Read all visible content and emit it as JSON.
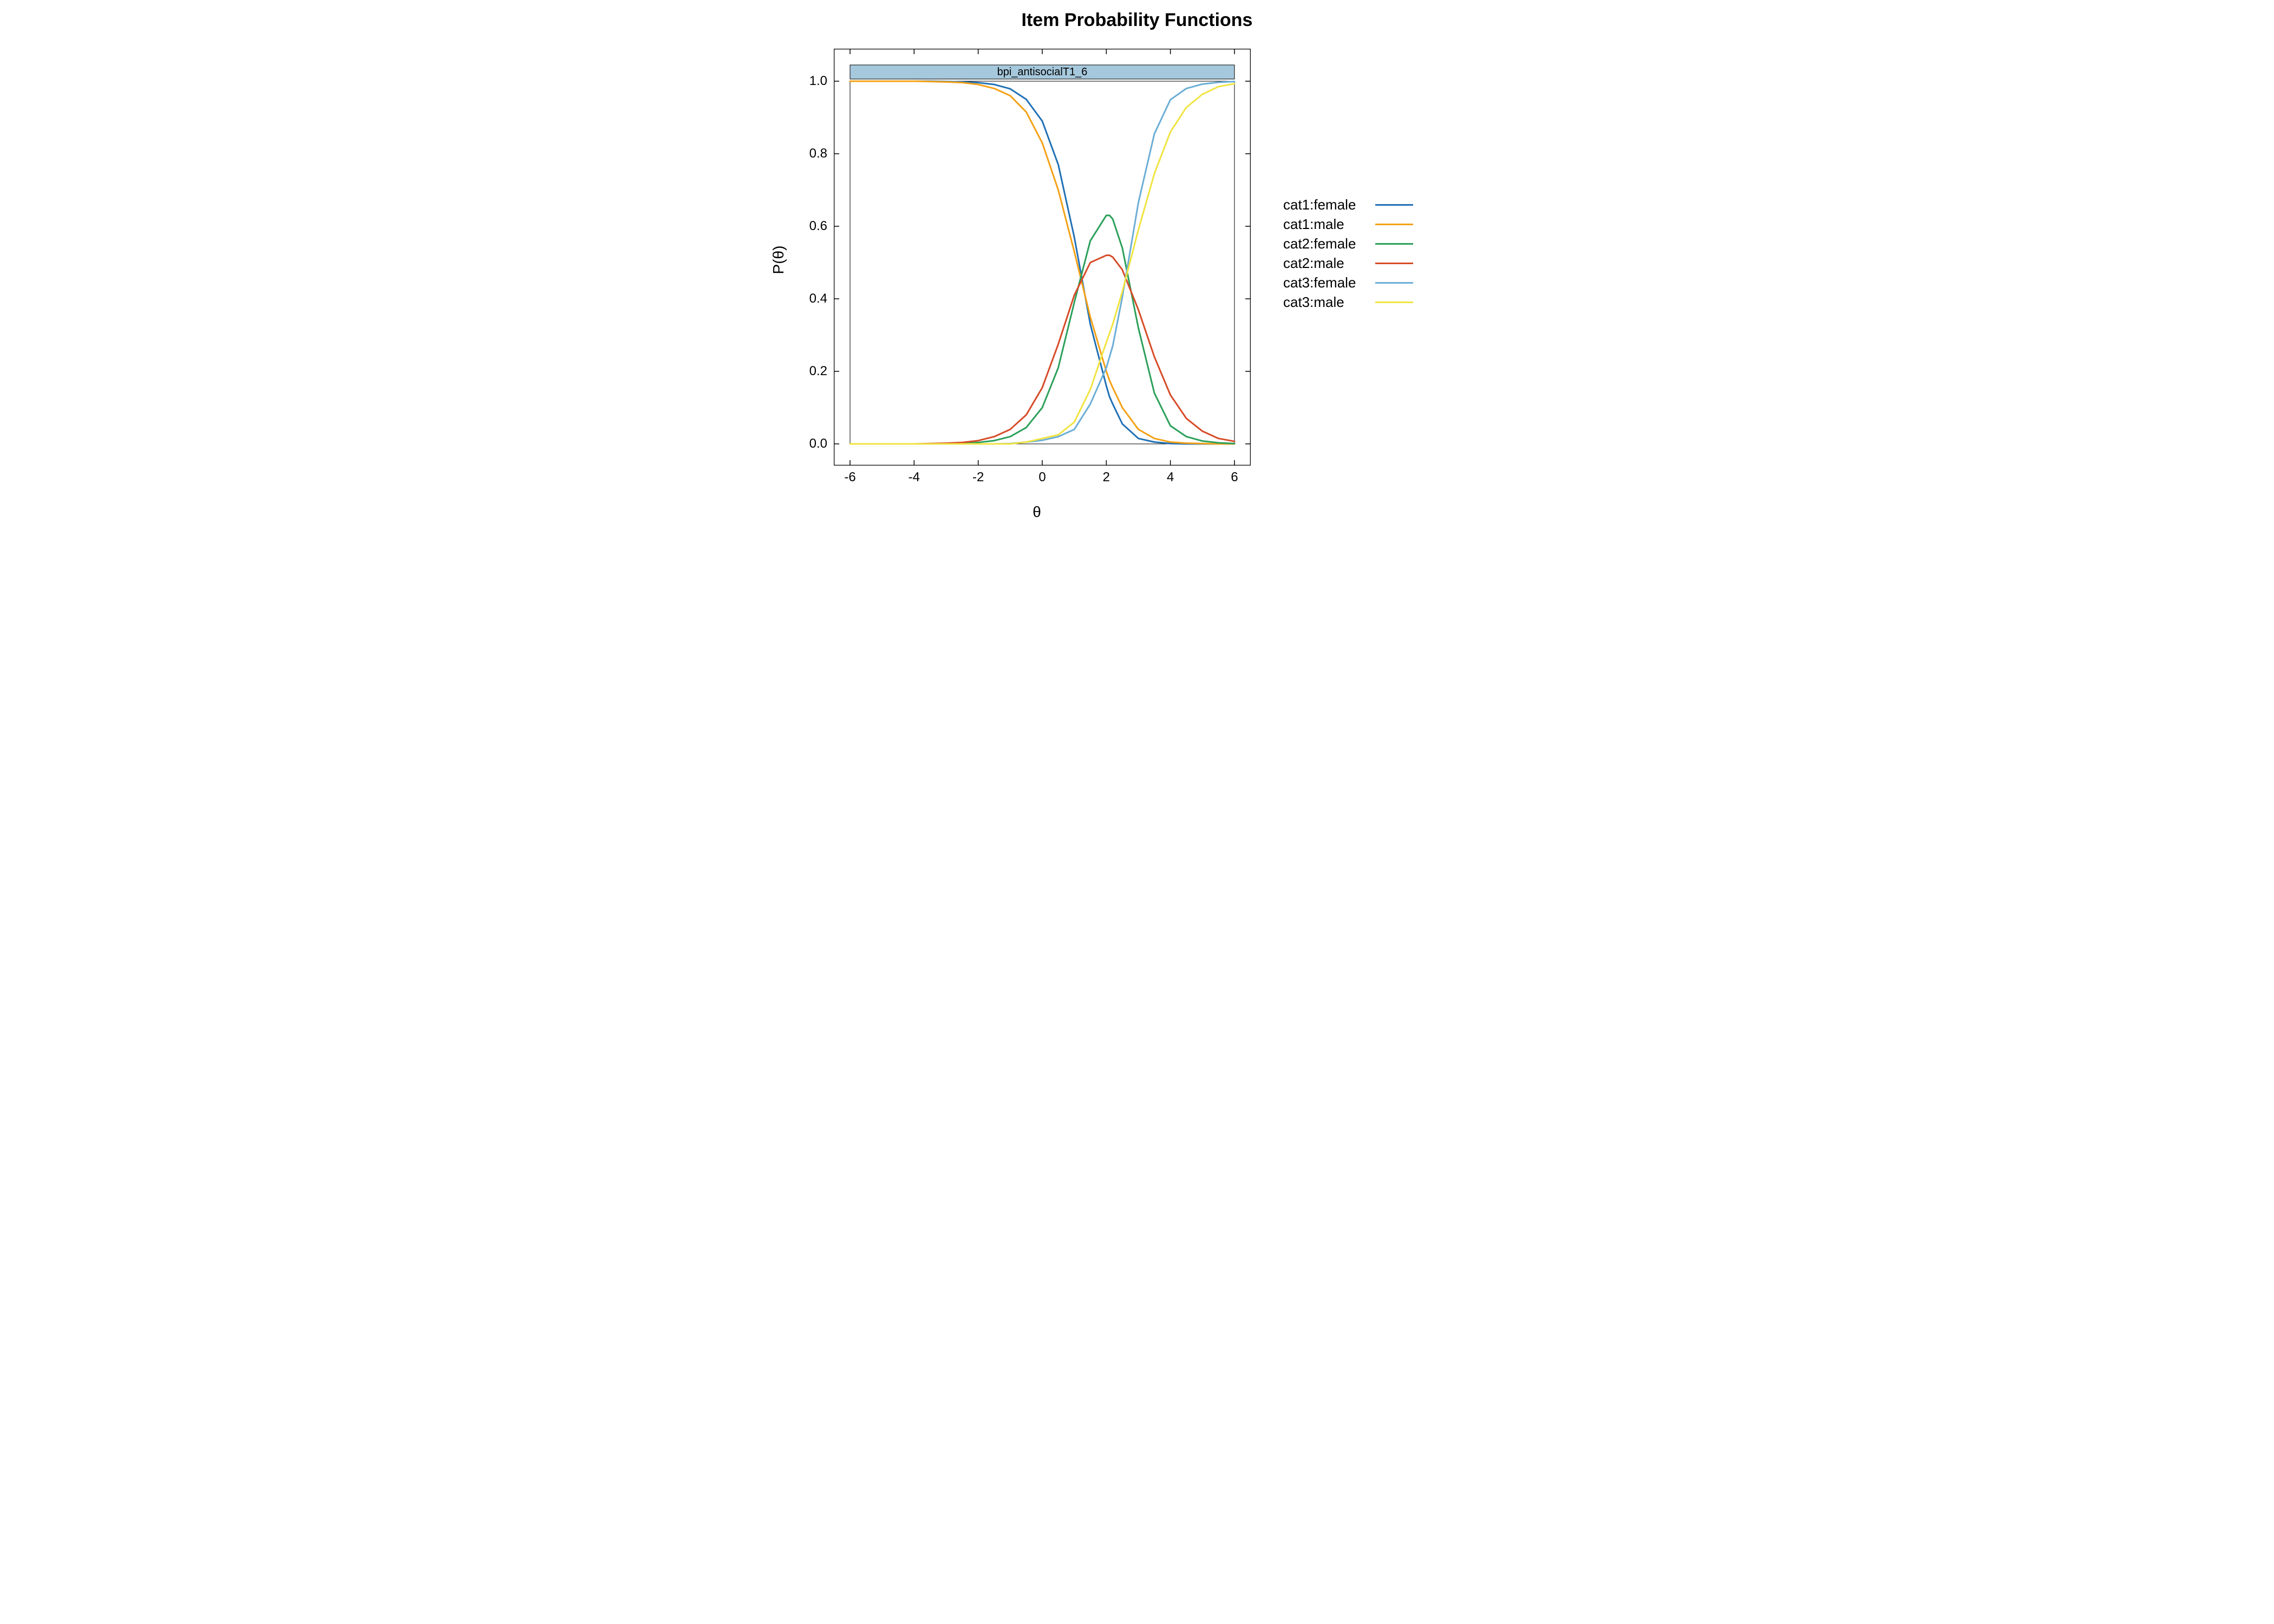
{
  "chart_data": {
    "type": "line",
    "title": "Item Probability Functions",
    "panel_label": "bpi_antisocialT1_6",
    "xlabel": "θ",
    "ylabel": "P(θ)",
    "xlim": [
      -6,
      6
    ],
    "ylim": [
      0,
      1
    ],
    "x_ticks": [
      -6,
      -4,
      -2,
      0,
      2,
      4,
      6
    ],
    "y_ticks": [
      0.0,
      0.2,
      0.4,
      0.6,
      0.8,
      1.0
    ],
    "colors": {
      "panel_strip": "#A6C8DC",
      "cat1_female": "#2171B5",
      "cat1_male": "#F4A117",
      "cat2_female": "#2CA05A",
      "cat2_male": "#D64B28",
      "cat3_female": "#6BAED6",
      "cat3_male": "#F0E442"
    },
    "legend": [
      {
        "label": "cat1:female",
        "color_key": "cat1_female"
      },
      {
        "label": "cat1:male",
        "color_key": "cat1_male"
      },
      {
        "label": "cat2:female",
        "color_key": "cat2_female"
      },
      {
        "label": "cat2:male",
        "color_key": "cat2_male"
      },
      {
        "label": "cat3:female",
        "color_key": "cat3_female"
      },
      {
        "label": "cat3:male",
        "color_key": "cat3_male"
      }
    ],
    "x": [
      -6.0,
      -5.5,
      -5.0,
      -4.5,
      -4.0,
      -3.5,
      -3.0,
      -2.5,
      -2.0,
      -1.5,
      -1.0,
      -0.5,
      0.0,
      0.5,
      1.0,
      1.5,
      2.0,
      2.1,
      2.2,
      2.5,
      3.0,
      3.5,
      4.0,
      4.5,
      5.0,
      5.5,
      6.0
    ],
    "series": [
      {
        "name": "cat1:female",
        "color_key": "cat1_female",
        "y": [
          1.0,
          1.0,
          1.0,
          1.0,
          1.0,
          1.0,
          0.999,
          0.998,
          0.996,
          0.991,
          0.979,
          0.95,
          0.89,
          0.77,
          0.57,
          0.33,
          0.16,
          0.13,
          0.11,
          0.055,
          0.015,
          0.005,
          0.001,
          0.0,
          0.0,
          0.0,
          0.0
        ]
      },
      {
        "name": "cat1:male",
        "color_key": "cat1_male",
        "y": [
          1.0,
          1.0,
          1.0,
          1.0,
          1.0,
          0.999,
          0.998,
          0.996,
          0.991,
          0.98,
          0.96,
          0.915,
          0.83,
          0.7,
          0.53,
          0.35,
          0.2,
          0.175,
          0.155,
          0.1,
          0.04,
          0.015,
          0.005,
          0.002,
          0.001,
          0.0,
          0.0
        ]
      },
      {
        "name": "cat2:female",
        "color_key": "cat2_female",
        "y": [
          0.0,
          0.0,
          0.0,
          0.0,
          0.0,
          0.0,
          0.001,
          0.002,
          0.004,
          0.009,
          0.02,
          0.045,
          0.1,
          0.21,
          0.39,
          0.56,
          0.63,
          0.63,
          0.62,
          0.54,
          0.32,
          0.14,
          0.05,
          0.02,
          0.008,
          0.003,
          0.001
        ]
      },
      {
        "name": "cat2:male",
        "color_key": "cat2_male",
        "y": [
          0.0,
          0.0,
          0.0,
          0.0,
          0.0,
          0.001,
          0.002,
          0.004,
          0.009,
          0.02,
          0.04,
          0.08,
          0.155,
          0.275,
          0.41,
          0.5,
          0.52,
          0.52,
          0.515,
          0.48,
          0.37,
          0.24,
          0.135,
          0.07,
          0.035,
          0.015,
          0.007
        ]
      },
      {
        "name": "cat3:female",
        "color_key": "cat3_female",
        "y": [
          0.0,
          0.0,
          0.0,
          0.0,
          0.0,
          0.0,
          0.0,
          0.0,
          0.0,
          0.0,
          0.001,
          0.005,
          0.01,
          0.02,
          0.04,
          0.11,
          0.21,
          0.24,
          0.27,
          0.405,
          0.665,
          0.855,
          0.949,
          0.98,
          0.992,
          0.997,
          0.999
        ]
      },
      {
        "name": "cat3:male",
        "color_key": "cat3_male",
        "y": [
          0.0,
          0.0,
          0.0,
          0.0,
          0.0,
          0.0,
          0.0,
          0.0,
          0.0,
          0.0,
          0.0,
          0.005,
          0.015,
          0.025,
          0.06,
          0.15,
          0.28,
          0.305,
          0.33,
          0.42,
          0.59,
          0.745,
          0.86,
          0.928,
          0.964,
          0.985,
          0.993
        ]
      }
    ]
  }
}
